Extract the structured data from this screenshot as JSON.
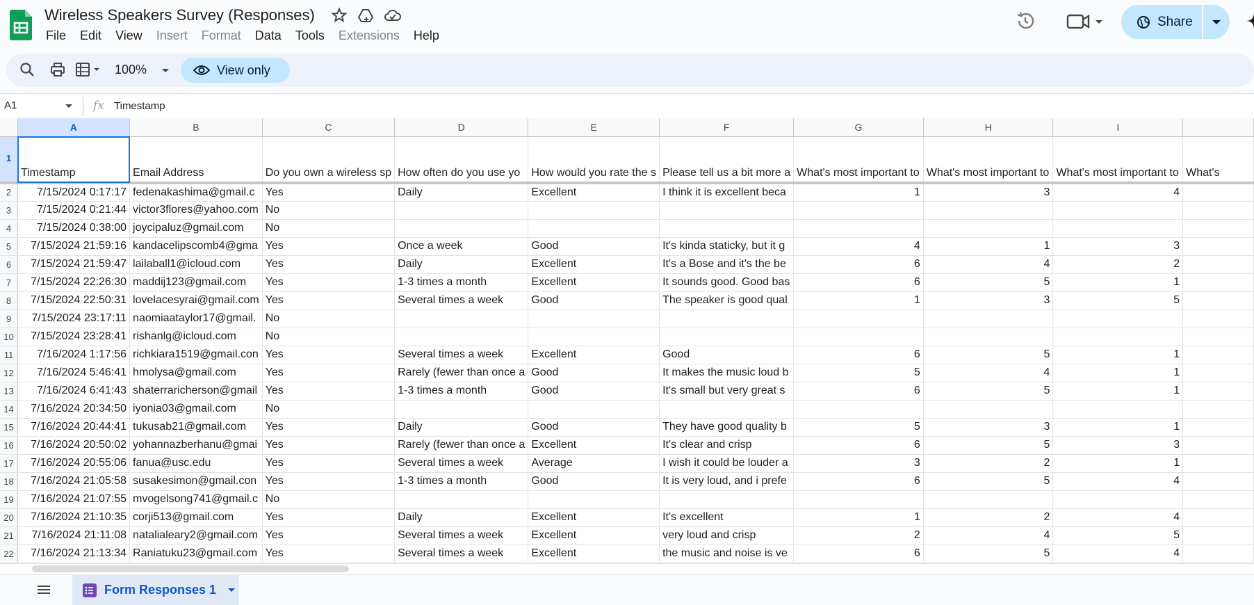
{
  "doc": {
    "title": "Wireless  Speakers Survey (Responses)"
  },
  "menu": [
    "File",
    "Edit",
    "View",
    "Insert",
    "Format",
    "Data",
    "Tools",
    "Extensions",
    "Help"
  ],
  "menu_disabled": [
    "Insert",
    "Format",
    "Extensions"
  ],
  "share": {
    "label": "Share"
  },
  "toolbar": {
    "zoom": "100%",
    "view_only_label": "View only"
  },
  "formula_bar": {
    "cell_ref": "A1",
    "fx": "fx",
    "content": "Timestamp"
  },
  "columns": [
    "A",
    "B",
    "C",
    "D",
    "E",
    "F",
    "G",
    "H",
    "I",
    ""
  ],
  "header_row": {
    "num": "1",
    "cells": [
      "Timestamp",
      "Email Address",
      "Do you own a wireless sp",
      "How often do you use yo",
      "How would you rate the s",
      "Please tell us a bit more a",
      "What's most important to",
      "What's most important to",
      "What's most important to",
      "What's"
    ]
  },
  "rows": [
    {
      "num": "2",
      "cells": [
        "7/15/2024 0:17:17",
        "fedenakashima@gmail.c",
        "Yes",
        "Daily",
        "Excellent",
        "I think it is excellent beca",
        "1",
        "3",
        "4",
        ""
      ]
    },
    {
      "num": "3",
      "cells": [
        "7/15/2024 0:21:44",
        "victor3flores@yahoo.com",
        "No",
        "",
        "",
        "",
        "",
        "",
        "",
        ""
      ]
    },
    {
      "num": "4",
      "cells": [
        "7/15/2024 0:38:00",
        "joycipaluz@gmail.com",
        "No",
        "",
        "",
        "",
        "",
        "",
        "",
        ""
      ]
    },
    {
      "num": "5",
      "cells": [
        "7/15/2024 21:59:16",
        "kandacelipscomb4@gma",
        "Yes",
        "Once a week",
        "Good",
        "It's kinda staticky, but it g",
        "4",
        "1",
        "3",
        ""
      ]
    },
    {
      "num": "6",
      "cells": [
        "7/15/2024 21:59:47",
        "lailaball1@icloud.com",
        "Yes",
        "Daily",
        "Excellent",
        "It's a Bose and it's the be",
        "6",
        "4",
        "2",
        ""
      ]
    },
    {
      "num": "7",
      "cells": [
        "7/15/2024 22:26:30",
        "maddij123@gmail.com",
        "Yes",
        "1-3 times a month",
        "Excellent",
        "It sounds good. Good bas",
        "6",
        "5",
        "1",
        ""
      ]
    },
    {
      "num": "8",
      "cells": [
        "7/15/2024 22:50:31",
        "lovelacesyrai@gmail.com",
        "Yes",
        "Several times a week",
        "Good",
        "The speaker is good qual",
        "1",
        "3",
        "5",
        ""
      ]
    },
    {
      "num": "9",
      "cells": [
        "7/15/2024 23:17:11",
        "naomiaataylor17@gmail.",
        "No",
        "",
        "",
        "",
        "",
        "",
        "",
        ""
      ]
    },
    {
      "num": "10",
      "cells": [
        "7/15/2024 23:28:41",
        "rishanlg@icloud.com",
        "No",
        "",
        "",
        "",
        "",
        "",
        "",
        ""
      ]
    },
    {
      "num": "11",
      "cells": [
        "7/16/2024 1:17:56",
        "richkiara1519@gmail.con",
        "Yes",
        "Several times a week",
        "Excellent",
        "Good",
        "6",
        "5",
        "1",
        ""
      ]
    },
    {
      "num": "12",
      "cells": [
        "7/16/2024 5:46:41",
        "hmolysa@gmail.com",
        "Yes",
        "Rarely (fewer than once a",
        "Good",
        "It makes the music loud b",
        "5",
        "4",
        "1",
        ""
      ]
    },
    {
      "num": "13",
      "cells": [
        "7/16/2024 6:41:43",
        "shaterraricherson@gmail",
        "Yes",
        "1-3 times a month",
        "Good",
        "It's small but very great s",
        "6",
        "5",
        "1",
        ""
      ]
    },
    {
      "num": "14",
      "cells": [
        "7/16/2024 20:34:50",
        "iyonia03@gmail.com",
        "No",
        "",
        "",
        "",
        "",
        "",
        "",
        ""
      ]
    },
    {
      "num": "15",
      "cells": [
        "7/16/2024 20:44:41",
        "tukusab21@gmail.com",
        "Yes",
        "Daily",
        "Good",
        "They have good quality b",
        "5",
        "3",
        "1",
        ""
      ]
    },
    {
      "num": "16",
      "cells": [
        "7/16/2024 20:50:02",
        "yohannazberhanu@gmai",
        "Yes",
        "Rarely (fewer than once a",
        "Excellent",
        "It's clear and crisp",
        "6",
        "5",
        "3",
        ""
      ]
    },
    {
      "num": "17",
      "cells": [
        "7/16/2024 20:55:06",
        "fanua@usc.edu",
        "Yes",
        "Several times a week",
        "Average",
        "I wish it could be louder a",
        "3",
        "2",
        "1",
        ""
      ]
    },
    {
      "num": "18",
      "cells": [
        "7/16/2024 21:05:58",
        "susakesimon@gmail.con",
        "Yes",
        "1-3 times a month",
        "Good",
        "It is very loud, and i prefe",
        "6",
        "5",
        "4",
        ""
      ]
    },
    {
      "num": "19",
      "cells": [
        "7/16/2024 21:07:55",
        "mvogelsong741@gmail.c",
        "No",
        "",
        "",
        "",
        "",
        "",
        "",
        ""
      ]
    },
    {
      "num": "20",
      "cells": [
        "7/16/2024 21:10:35",
        "corji513@gmail.com",
        "Yes",
        "Daily",
        "Excellent",
        "It's excellent",
        "1",
        "2",
        "4",
        ""
      ]
    },
    {
      "num": "21",
      "cells": [
        "7/16/2024 21:11:08",
        "natalialeary2@gmail.com",
        "Yes",
        "Several times a week",
        "Excellent",
        "very loud and crisp",
        "2",
        "4",
        "5",
        ""
      ]
    },
    {
      "num": "22",
      "cells": [
        "7/16/2024 21:13:34",
        "Raniatuku23@gmail.com",
        "Yes",
        "Several times a week",
        "Excellent",
        "the music and noise is ve",
        "6",
        "5",
        "4",
        ""
      ]
    }
  ],
  "numeric_columns": [
    0,
    6,
    7,
    8
  ],
  "sheet_tab": {
    "label": "Form Responses 1"
  },
  "colors": {
    "accent": "#0b57d0",
    "sheets_green": "#0f9d58",
    "share_bg": "#c2e7ff",
    "tab_purple": "#7248b9"
  }
}
